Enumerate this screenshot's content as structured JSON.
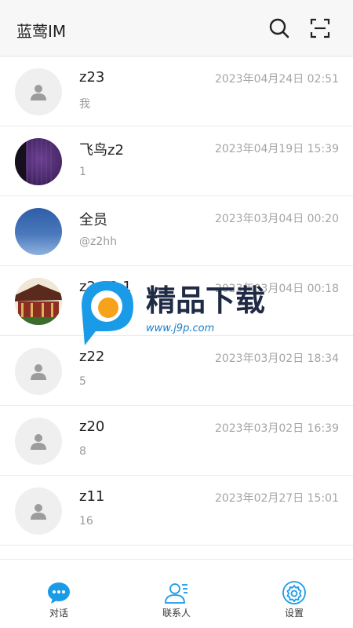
{
  "app": {
    "title": "蓝莺IM"
  },
  "conversations": [
    {
      "name": "z23",
      "time": "2023年04月24日 02:51",
      "preview": "我",
      "avatar": "default-avatar-icon"
    },
    {
      "name": "飞鸟z2",
      "time": "2023年04月19日 15:39",
      "preview": "1",
      "avatar": "purple-photo"
    },
    {
      "name": "全员",
      "time": "2023年03月04日 00:20",
      "preview": "@z2hh",
      "avatar": "blue-sky-photo"
    },
    {
      "name": "z2 · 2 1",
      "time": "2023年03月04日 00:18",
      "preview": "",
      "avatar": "temple-photo"
    },
    {
      "name": "z22",
      "time": "2023年03月02日 18:34",
      "preview": "5",
      "avatar": "default-avatar-icon"
    },
    {
      "name": "z20",
      "time": "2023年03月02日 16:39",
      "preview": "8",
      "avatar": "default-avatar-icon"
    },
    {
      "name": "z11",
      "time": "2023年02月27日 15:01",
      "preview": "16",
      "avatar": "default-avatar-icon"
    }
  ],
  "tabs": [
    {
      "label": "对话",
      "icon": "chat-bubble-icon",
      "active": true
    },
    {
      "label": "联系人",
      "icon": "contacts-icon",
      "active": false
    },
    {
      "label": "设置",
      "icon": "settings-gear-icon",
      "active": false
    }
  ],
  "watermark": {
    "brand": "精品下载",
    "url": "www.j9p.com"
  },
  "colors": {
    "accent": "#1a9be8",
    "text_muted": "#9a9a9a",
    "divider": "#ebebeb"
  }
}
